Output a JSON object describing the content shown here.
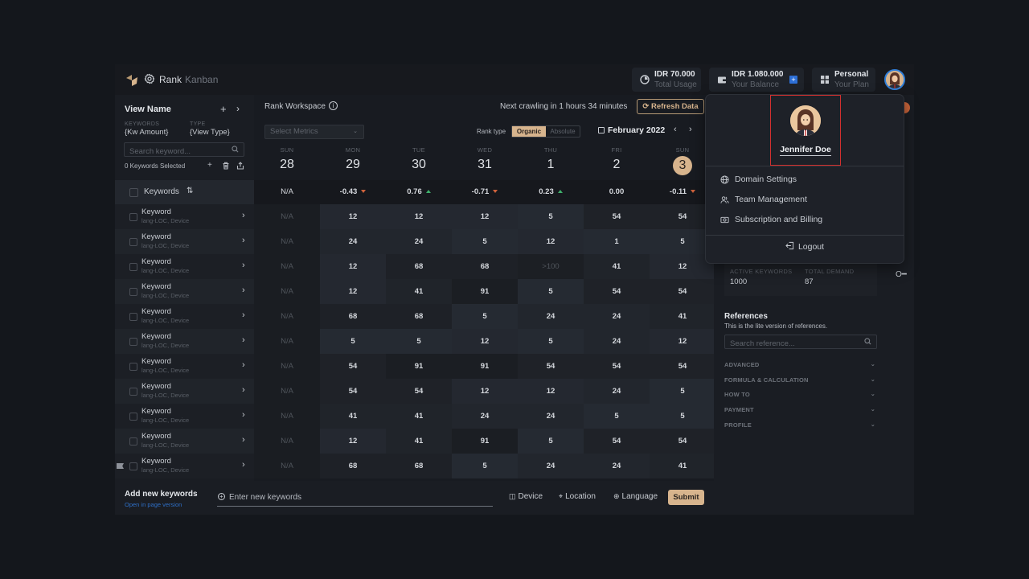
{
  "header": {
    "title": "Rank",
    "subtitle": "Kanban",
    "total_usage": {
      "value": "IDR 70.000",
      "label": "Total Usage",
      "icon": "pie-chart-icon"
    },
    "balance": {
      "value": "IDR 1.080.000",
      "label": "Your Balance",
      "icon": "wallet-icon",
      "add": "+"
    },
    "plan": {
      "value": "Personal",
      "label": "Your Plan",
      "icon": "grid-icon"
    }
  },
  "left_panel": {
    "view_name": "View Name",
    "keywords_label": "KEYWORDS",
    "keywords_value": "{Kw Amount}",
    "type_label": "TYPE",
    "type_value": "{View Type}",
    "search_placeholder": "Search keyword...",
    "selected_count": "0 Keywords Selected",
    "column_header": "Keywords"
  },
  "workspace": {
    "title": "Rank Workspace",
    "crawl_status": "Next crawling in 1 hours 34 minutes",
    "refresh_label": "Refresh Data",
    "metrics_placeholder": "Select Metrics",
    "rank_type_label": "Rank type",
    "rank_type_options": [
      "Organic",
      "Absolute"
    ],
    "rank_type_selected": "Organic",
    "month": "February 2022"
  },
  "days": [
    {
      "name": "SUN",
      "date": "28",
      "delta": "N/A",
      "trend": "none"
    },
    {
      "name": "MON",
      "date": "29",
      "delta": "-0.43",
      "trend": "down"
    },
    {
      "name": "TUE",
      "date": "30",
      "delta": "0.76",
      "trend": "up"
    },
    {
      "name": "WED",
      "date": "31",
      "delta": "-0.71",
      "trend": "down"
    },
    {
      "name": "THU",
      "date": "1",
      "delta": "0.23",
      "trend": "up"
    },
    {
      "name": "FRI",
      "date": "2",
      "delta": "0.00",
      "trend": "none"
    },
    {
      "name": "SUN",
      "date": "3",
      "delta": "-0.11",
      "trend": "down",
      "today": true
    }
  ],
  "keywords": [
    {
      "name": "Keyword",
      "meta": "lang-LOC, Device",
      "ranks": [
        "N/A",
        "12",
        "12",
        "12",
        "5",
        "54",
        "54"
      ]
    },
    {
      "name": "Keyword",
      "meta": "lang-LOC, Device",
      "ranks": [
        "N/A",
        "24",
        "24",
        "5",
        "12",
        "1",
        "5"
      ]
    },
    {
      "name": "Keyword",
      "meta": "lang-LOC, Device",
      "ranks": [
        "N/A",
        "12",
        "68",
        "68",
        ">100",
        "41",
        "12"
      ]
    },
    {
      "name": "Keyword",
      "meta": "lang-LOC, Device",
      "ranks": [
        "N/A",
        "12",
        "41",
        "91",
        "5",
        "54",
        "54"
      ]
    },
    {
      "name": "Keyword",
      "meta": "lang-LOC, Device",
      "ranks": [
        "N/A",
        "68",
        "68",
        "5",
        "24",
        "24",
        "41"
      ]
    },
    {
      "name": "Keyword",
      "meta": "lang-LOC, Device",
      "ranks": [
        "N/A",
        "5",
        "5",
        "12",
        "5",
        "24",
        "12"
      ]
    },
    {
      "name": "Keyword",
      "meta": "lang-LOC, Device",
      "ranks": [
        "N/A",
        "54",
        "91",
        "91",
        "54",
        "54",
        "54"
      ]
    },
    {
      "name": "Keyword",
      "meta": "lang-LOC, Device",
      "ranks": [
        "N/A",
        "54",
        "54",
        "12",
        "12",
        "24",
        "5"
      ]
    },
    {
      "name": "Keyword",
      "meta": "lang-LOC, Device",
      "ranks": [
        "N/A",
        "41",
        "41",
        "24",
        "24",
        "5",
        "5"
      ]
    },
    {
      "name": "Keyword",
      "meta": "lang-LOC, Device",
      "ranks": [
        "N/A",
        "12",
        "41",
        "91",
        "5",
        "54",
        "54"
      ]
    },
    {
      "name": "Keyword",
      "meta": "lang-LOC, Device",
      "ranks": [
        "N/A",
        "68",
        "68",
        "5",
        "24",
        "24",
        "41"
      ]
    }
  ],
  "bottom": {
    "add_title": "Add new keywords",
    "open_page": "Open in page version",
    "input_placeholder": "Enter new keywords",
    "device": "Device",
    "location": "Location",
    "language": "Language",
    "submit": "Submit"
  },
  "right_panel": {
    "active_keywords_label": "ACTIVE KEYWORDS",
    "active_keywords": "1000",
    "total_demand_label": "TOTAL DEMAND",
    "total_demand": "87",
    "references_title": "References",
    "references_sub": "This is the lite version of references.",
    "search_placeholder": "Search reference...",
    "sections": [
      "ADVANCED",
      "FORMULA & CALCULATION",
      "HOW TO",
      "PAYMENT",
      "PROFILE"
    ]
  },
  "profile_menu": {
    "user_name": "Jennifer Doe",
    "items": [
      {
        "label": "Domain Settings",
        "icon": "globe-icon"
      },
      {
        "label": "Team Management",
        "icon": "users-icon"
      },
      {
        "label": "Subscription and Billing",
        "icon": "billing-icon"
      }
    ],
    "logout": "Logout"
  },
  "colors": {
    "accent": "#d7b48d",
    "link": "#2e6fc6",
    "down": "#d0623c",
    "up": "#3fb06b",
    "highlight_border": "#d2302f",
    "avatar_ring": "#2f7ed8"
  }
}
